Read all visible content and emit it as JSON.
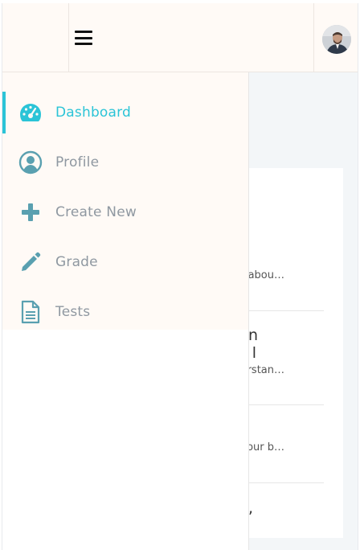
{
  "header": {
    "menu_icon": "hamburger-icon",
    "avatar_icon": "user-avatar"
  },
  "sidebar": {
    "items": [
      {
        "label": "Dashboard",
        "icon": "dashboard-gauge-icon",
        "active": true
      },
      {
        "label": "Profile",
        "icon": "user-circle-icon",
        "active": false
      },
      {
        "label": "Create New",
        "icon": "plus-icon",
        "active": false
      },
      {
        "label": "Grade",
        "icon": "pencil-icon",
        "active": false
      },
      {
        "label": "Tests",
        "icon": "document-icon",
        "active": false
      }
    ]
  },
  "background": {
    "line1": "abou…",
    "line2": "n",
    "line3": "l",
    "line4": "rstan…",
    "line5": "our b…",
    "line6": ","
  },
  "colors": {
    "accent": "#2bc4d7",
    "icon": "#5aa0b0",
    "label": "#8f98a1",
    "drawer_bg": "#fffaf6"
  }
}
